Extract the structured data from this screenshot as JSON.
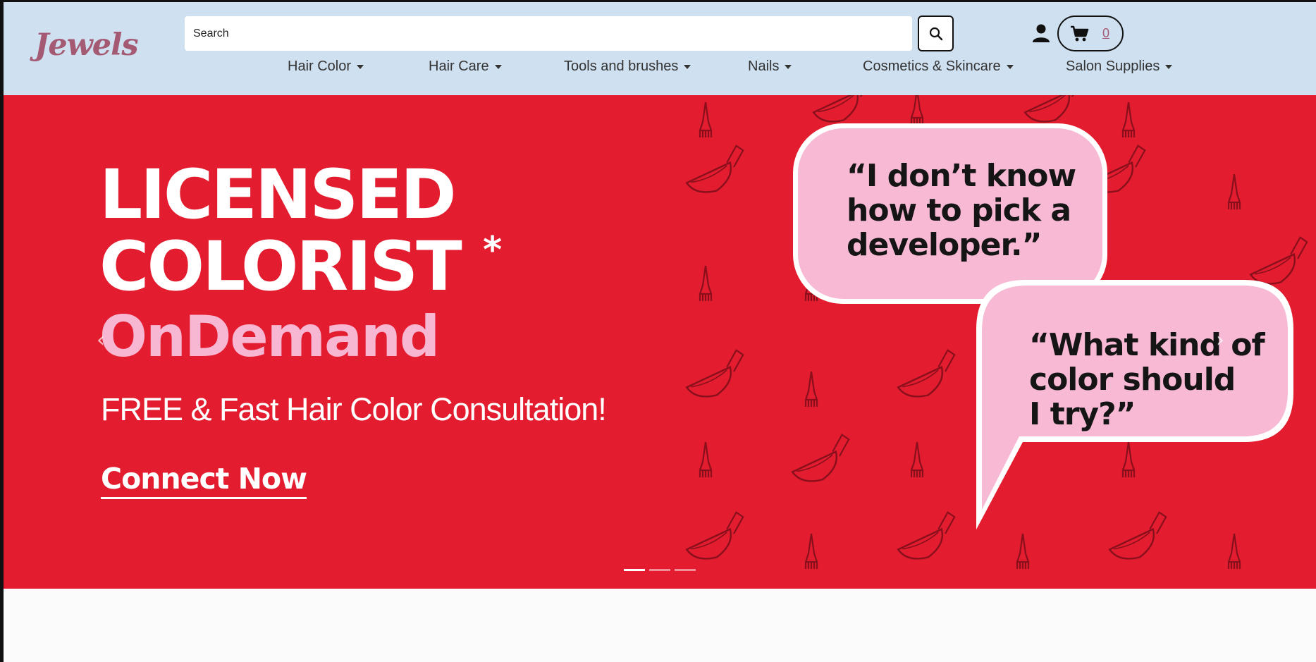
{
  "header": {
    "logo": "Jewels",
    "search": {
      "placeholder": "Search"
    },
    "cart_count": "0"
  },
  "nav": [
    {
      "label": "Hair Color"
    },
    {
      "label": "Hair Care"
    },
    {
      "label": "Tools and brushes"
    },
    {
      "label": "Nails"
    },
    {
      "label": "Cosmetics & Skincare"
    },
    {
      "label": "Salon Supplies"
    }
  ],
  "hero": {
    "title_line1": "LICENSED",
    "title_line2": "COLORIST",
    "asterisk": "*",
    "title_pink": "OnDemand",
    "subtitle": "FREE & Fast Hair Color Consultation!",
    "cta": "Connect Now",
    "bubble1": [
      "“I don’t know",
      "how to pick a",
      "developer.”"
    ],
    "bubble2": [
      "“What kind of",
      "color should",
      "I try?”"
    ],
    "prev_arrow": "‹",
    "next_arrow": "›",
    "slides": 3,
    "active_slide": 1
  },
  "colors": {
    "header_bg": "#cfe0f0",
    "hero_bg": "#e31d2f",
    "pink": "#f7b7d2",
    "logo": "#a45a72"
  }
}
